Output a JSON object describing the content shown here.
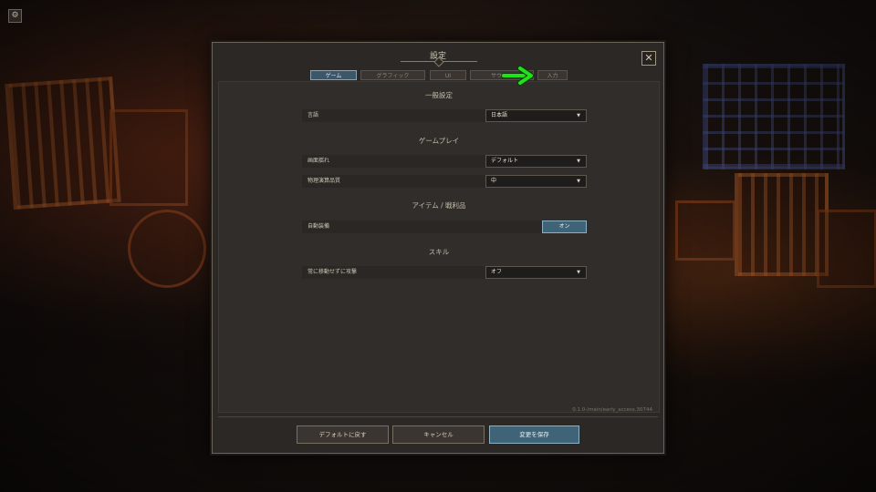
{
  "dialog": {
    "title": "設定",
    "close_glyph": "✕"
  },
  "corner_icon": "gear-icon",
  "tabs": [
    {
      "label": "ゲーム",
      "active": true
    },
    {
      "label": "グラフィック",
      "active": false
    },
    {
      "label": "UI",
      "active": false
    },
    {
      "label": "サウンド",
      "active": false
    },
    {
      "label": "入力",
      "active": false
    }
  ],
  "sections": {
    "general": {
      "title": "一般設定",
      "language": {
        "label": "言語",
        "value": "日本語"
      }
    },
    "gameplay": {
      "title": "ゲームプレイ",
      "screen_shake": {
        "label": "画面揺れ",
        "value": "デフォルト"
      },
      "physics_quality": {
        "label": "物理演算品質",
        "value": "中"
      }
    },
    "items": {
      "title": "アイテム / 戦利品",
      "auto_equip": {
        "label": "自動装備",
        "value": "オン"
      }
    },
    "skills": {
      "title": "スキル",
      "attack_in_place": {
        "label": "常に移動せずに攻撃",
        "value": "オフ"
      }
    }
  },
  "version": "0.1.0-/main/early_access.30744",
  "footer": {
    "reset": "デフォルトに戻す",
    "cancel": "キャンセル",
    "save": "変更を保存"
  },
  "annotation": {
    "color": "#22e01a"
  },
  "colors": {
    "accent": "#3f6478",
    "panel": "#2b2826"
  }
}
